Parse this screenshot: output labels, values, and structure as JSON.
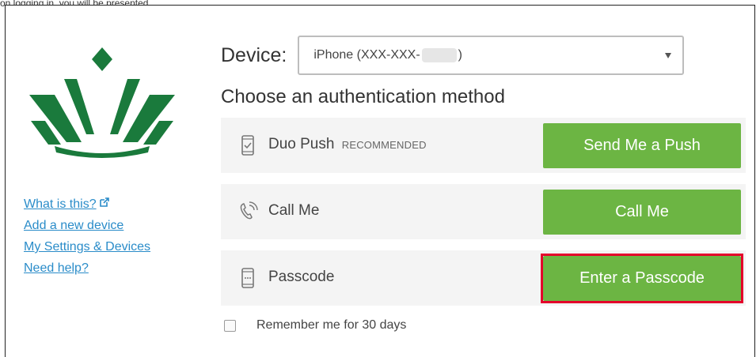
{
  "top_caption": "on logging in, you will be presented",
  "sidebar": {
    "links": [
      {
        "label": "What is this?",
        "external": true
      },
      {
        "label": "Add a new device"
      },
      {
        "label": "My Settings & Devices"
      },
      {
        "label": "Need help?"
      }
    ]
  },
  "device": {
    "label": "Device:",
    "value_prefix": "iPhone (XXX-XXX-",
    "value_suffix": ")"
  },
  "heading": "Choose an authentication method",
  "methods": [
    {
      "icon": "phone-push-icon",
      "label": "Duo Push",
      "tag": "RECOMMENDED",
      "button": "Send Me a Push"
    },
    {
      "icon": "phone-call-icon",
      "label": "Call Me",
      "button": "Call Me"
    },
    {
      "icon": "passcode-icon",
      "label": "Passcode",
      "button": "Enter a Passcode",
      "highlighted": true
    }
  ],
  "remember": {
    "label": "Remember me for 30 days",
    "checked": false
  },
  "colors": {
    "button_green": "#6cb543",
    "logo_green": "#1a7a3c",
    "link_blue": "#2a8cc9",
    "highlight_red": "#e4002b",
    "row_gray": "#f4f4f4"
  }
}
